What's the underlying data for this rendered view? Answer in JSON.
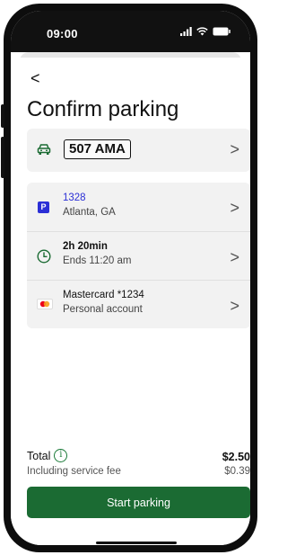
{
  "status": {
    "time": "09:00"
  },
  "header": {
    "back_icon": "chevron-left-icon",
    "back_glyph": "<",
    "title": "Confirm parking"
  },
  "vehicle": {
    "icon": "car-icon",
    "plate": "507 AMA"
  },
  "details": {
    "location": {
      "icon": "parking-p-icon",
      "badge": "P",
      "zone": "1328",
      "city": "Atlanta, GA"
    },
    "duration": {
      "icon": "clock-icon",
      "length": "2h 20min",
      "ends": "Ends 11:20 am"
    },
    "payment": {
      "icon": "mastercard-icon",
      "card": "Mastercard *1234",
      "account": "Personal account"
    }
  },
  "summary": {
    "total_label": "Total",
    "total_value": "$2.50",
    "info_glyph": "i",
    "fee_label": "Including service fee",
    "fee_value": "$0.39"
  },
  "action": {
    "start_label": "Start parking"
  },
  "colors": {
    "accent_green": "#1b6b33",
    "zone_blue": "#2b2fd6",
    "card_bg": "#f2f2f2"
  }
}
